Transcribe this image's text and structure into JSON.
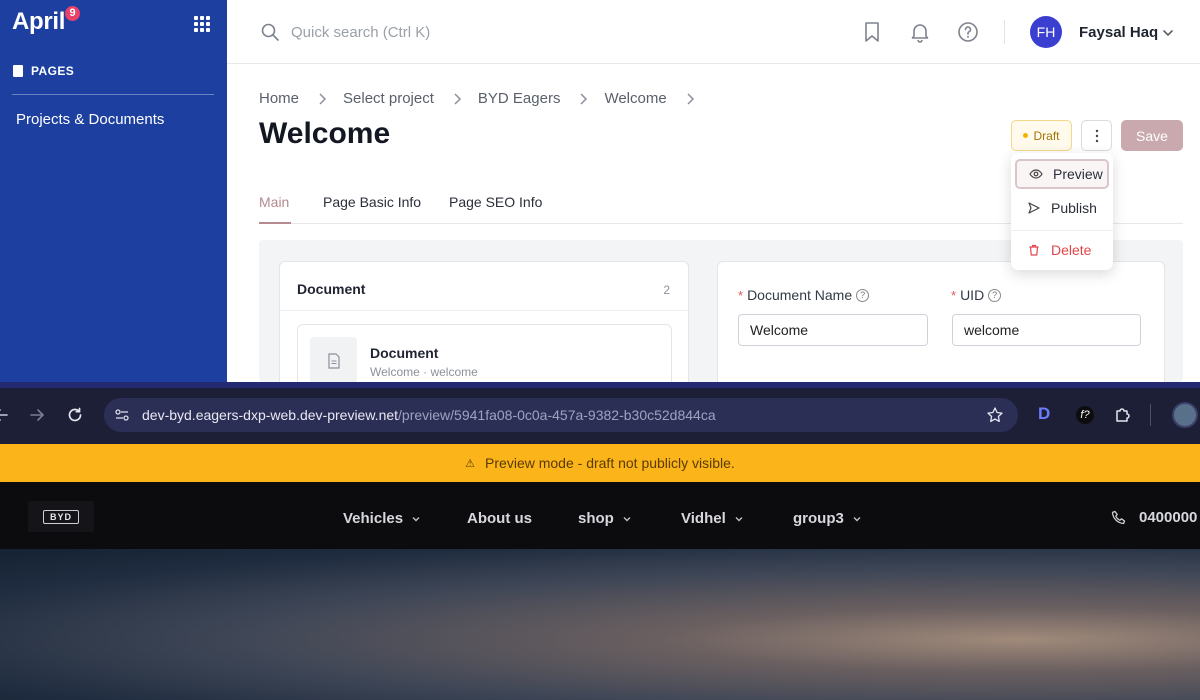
{
  "sidebar": {
    "logo_text": "April",
    "logo_badge": "9",
    "section_label": "PAGES",
    "items": [
      {
        "label": "Projects & Documents"
      }
    ]
  },
  "topbar": {
    "search_placeholder": "Quick search (Ctrl K)",
    "user_initials": "FH",
    "user_name": "Faysal Haq"
  },
  "breadcrumb": [
    "Home",
    "Select project",
    "BYD Eagers",
    "Welcome"
  ],
  "page": {
    "title": "Welcome",
    "status": "Draft",
    "save_label": "Save"
  },
  "tabs": [
    {
      "label": "Main",
      "active": true
    },
    {
      "label": "Page Basic Info",
      "active": false
    },
    {
      "label": "Page SEO Info",
      "active": false
    }
  ],
  "dropdown": {
    "items": [
      {
        "label": "Preview",
        "icon": "eye-icon"
      },
      {
        "label": "Publish",
        "icon": "send-icon"
      },
      {
        "label": "Delete",
        "icon": "trash-icon"
      }
    ]
  },
  "document_panel": {
    "heading": "Document",
    "count": "2",
    "item_name": "Document",
    "item_sub": "Welcome · welcome"
  },
  "form": {
    "document_name_label": "Document Name",
    "document_name_value": "Welcome",
    "uid_label": "UID",
    "uid_value": "welcome",
    "required_mark": "*",
    "help_mark": "?"
  },
  "browser": {
    "url_host": "dev-byd.eagers-dxp-web.dev-preview.net",
    "url_path": "/preview/5941fa08-0c0a-457a-9382-b30c52d844ca",
    "ext_d": "D",
    "ext_f": "f?"
  },
  "preview_site": {
    "banner_icon": "⚠",
    "banner": "Preview mode - draft not publicly visible.",
    "logo": "BYD",
    "nav": [
      {
        "label": "Vehicles",
        "has_dropdown": true
      },
      {
        "label": "About us",
        "has_dropdown": false
      },
      {
        "label": "shop",
        "has_dropdown": true
      },
      {
        "label": "Vidhel",
        "has_dropdown": true
      },
      {
        "label": "group3",
        "has_dropdown": true
      }
    ],
    "phone": "0400000"
  },
  "colors": {
    "sidebar": "#1c3fa0",
    "accent": "#b48a8f",
    "banner": "#fbb41a",
    "browser": "#1d1f36",
    "site_nav": "#0c0c0f"
  }
}
